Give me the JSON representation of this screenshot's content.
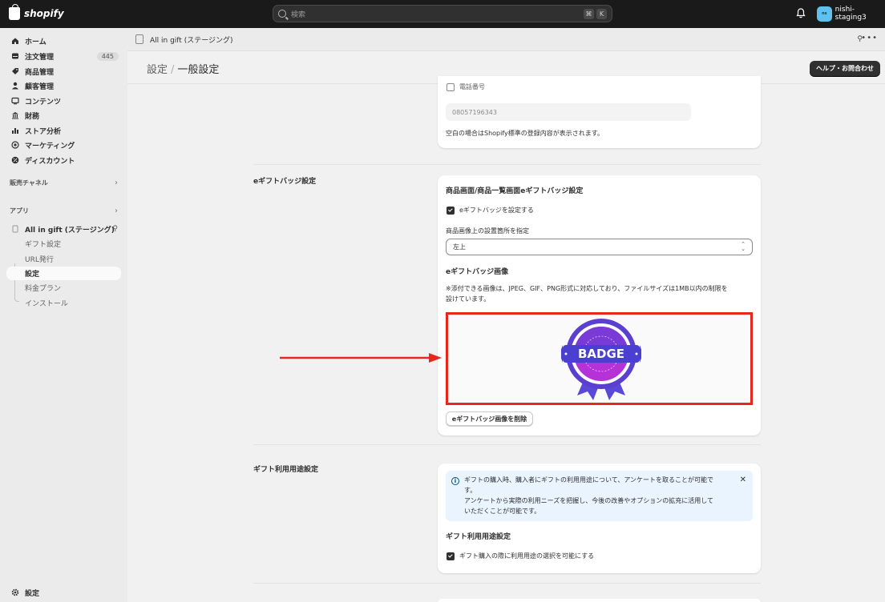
{
  "topbar": {
    "logo": "shopify",
    "search_placeholder": "検索",
    "kbd_cmd": "⌘",
    "kbd_k": "K",
    "store_avatar": "ns",
    "store_name": "nishi-staging3"
  },
  "sidebar": {
    "items": [
      {
        "label": "ホーム",
        "icon": "home-icon"
      },
      {
        "label": "注文管理",
        "icon": "inbox-icon",
        "badge": "445"
      },
      {
        "label": "商品管理",
        "icon": "tag-icon"
      },
      {
        "label": "顧客管理",
        "icon": "person-icon"
      },
      {
        "label": "コンテンツ",
        "icon": "content-icon"
      },
      {
        "label": "財務",
        "icon": "bank-icon"
      },
      {
        "label": "ストア分析",
        "icon": "bar-chart-icon"
      },
      {
        "label": "マーケティング",
        "icon": "target-icon"
      },
      {
        "label": "ディスカウント",
        "icon": "discount-icon"
      }
    ],
    "sales_channels": "販売チャネル",
    "apps": "アプリ",
    "app_name": "All in gift (ステージング)",
    "app_subitems": [
      "ギフト設定",
      "URL発行",
      "設定",
      "料金プラン",
      "インストール"
    ],
    "settings": "設定"
  },
  "appbar": {
    "title": "All in gift (ステージング)"
  },
  "page": {
    "crumb_parent": "設定",
    "crumb_sep": "/",
    "crumb_current": "一般設定",
    "help_button": "ヘルプ・お問合わせ"
  },
  "phone_card": {
    "checkbox_label": "電話番号",
    "phone_value": "08057196343",
    "hint": "空白の場合はShopify標準の登録内容が表示されます。"
  },
  "badge_section": {
    "title": "eギフトバッジ設定",
    "card_title": "商品画面/商品一覧画面eギフトバッジ設定",
    "enable_label": "eギフトバッジを設定する",
    "position_label": "商品画像上の設置箇所を指定",
    "position_value": "左上",
    "image_title": "eギフトバッジ画像",
    "image_note_1": "※添付できる画像は、JPEG、GIF、PNG形式に対応しており、ファイルサイズは1MB以内の制限を",
    "image_note_2": "設けています。",
    "badge_text": "BADGE",
    "delete_button": "eギフトバッジ画像を削除"
  },
  "usage_section": {
    "title": "ギフト利用用途設定",
    "banner_line1": "ギフトの購入時、購入者にギフトの利用用途について、アンケートを取ることが可能で",
    "banner_line2": "す。",
    "banner_line3": "アンケートから実際の利用ニーズを把握し、今後の改善やオプションの拡充に活用して",
    "banner_line4": "いただくことが可能です。",
    "subtitle": "ギフト利用用途設定",
    "checkbox_label": "ギフト購入の際に利用用途の選択を可能にする"
  },
  "colors": {
    "annotation_red": "#e8271c",
    "badge_purple": "#6b3fd4",
    "badge_magenta": "#c42fd6"
  }
}
